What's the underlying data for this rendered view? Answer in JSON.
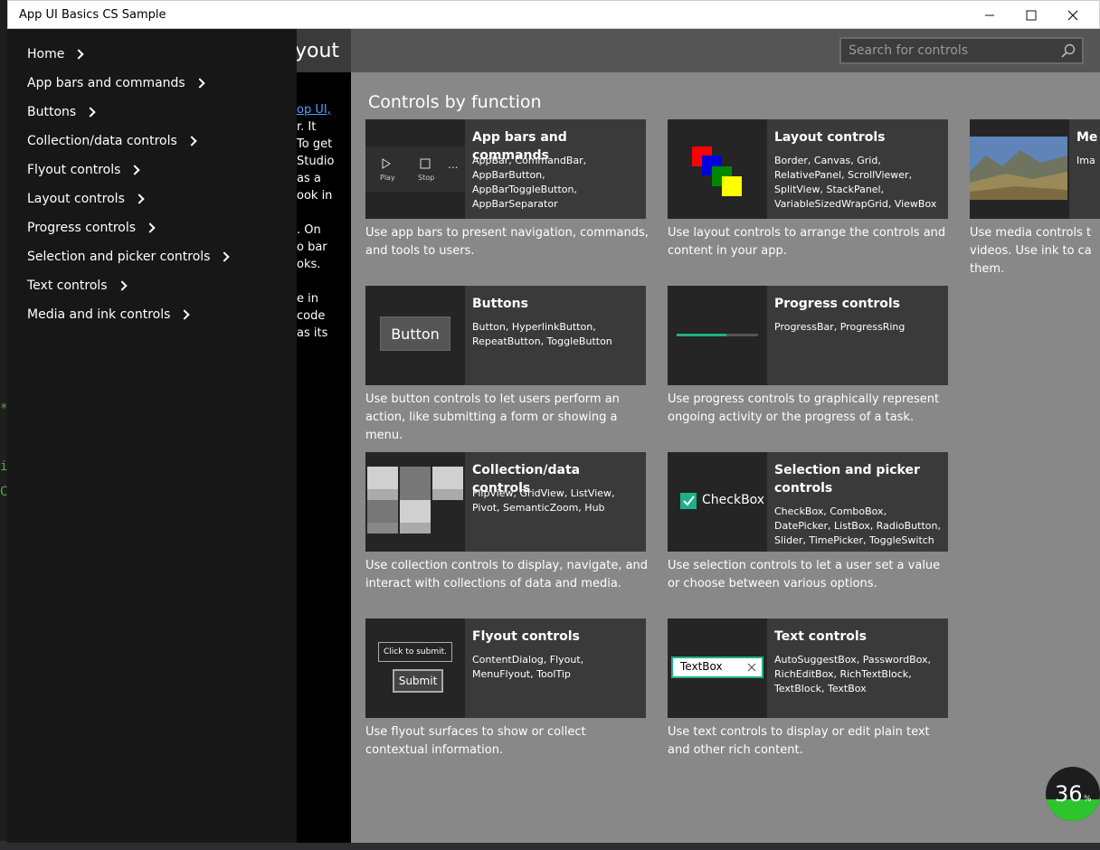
{
  "window": {
    "title": "App UI Basics CS Sample"
  },
  "header": {
    "page_title": "yout"
  },
  "search": {
    "placeholder": "Search for controls"
  },
  "nav": {
    "items": [
      {
        "label": "Home"
      },
      {
        "label": "App bars and commands"
      },
      {
        "label": "Buttons"
      },
      {
        "label": "Collection/data controls"
      },
      {
        "label": "Flyout controls"
      },
      {
        "label": "Layout controls"
      },
      {
        "label": "Progress controls"
      },
      {
        "label": "Selection and picker controls"
      },
      {
        "label": "Text controls"
      },
      {
        "label": "Media and ink controls"
      }
    ]
  },
  "intro": {
    "lines": [
      "op UI,",
      "r. It",
      "",
      "To get",
      "Studio",
      "as a",
      "ook in",
      "",
      ". On",
      "o bar",
      "oks.",
      "",
      "e in",
      "code",
      "as its"
    ]
  },
  "main": {
    "section_title": "Controls by function",
    "tiles": [
      {
        "title": "App bars and commands",
        "controls": "AppBar, CommandBar, AppBarButton, AppBarToggleButton, AppBarSeparator",
        "description": "Use app bars to present navigation, commands, and tools to users."
      },
      {
        "title": "Layout controls",
        "controls": "Border, Canvas, Grid, RelativePanel, ScrollViewer, SplitView, StackPanel, VariableSizedWrapGrid, ViewBox",
        "description": "Use layout controls to arrange the controls and content in your app."
      },
      {
        "title": "Me",
        "controls": "Ima",
        "description": "Use media controls t videos. Use ink to ca them."
      },
      {
        "title": "Buttons",
        "controls": "Button, HyperlinkButton, RepeatButton, ToggleButton",
        "description": "Use button controls to let users perform an action, like submitting a form or showing a menu."
      },
      {
        "title": "Progress controls",
        "controls": "ProgressBar, ProgressRing",
        "description": "Use progress controls to graphically represent ongoing activity or the progress of a task."
      },
      {
        "title": "Collection/data controls",
        "controls": "FlipView, GridView, ListView, Pivot, SemanticZoom, Hub",
        "description": "Use collection controls to display, navigate, and interact with collections of data and media."
      },
      {
        "title": "Selection and picker controls",
        "controls": "CheckBox, ComboBox, DatePicker, ListBox, RadioButton, Slider, TimePicker, ToggleSwitch",
        "description": "Use selection controls to let a user set a value or choose between various options."
      },
      {
        "title": "Flyout controls",
        "controls": "ContentDialog, Flyout, MenuFlyout, ToolTip",
        "description": "Use flyout surfaces to show or collect contextual information."
      },
      {
        "title": "Text controls",
        "controls": "AutoSuggestBox, PasswordBox, RichEditBox, RichTextBlock, TextBlock, TextBox",
        "description": "Use text controls to display or edit plain text and other rich content."
      }
    ],
    "thumbs": {
      "appbar_play": "Play",
      "appbar_stop": "Stop",
      "appbar_more": "...",
      "button_label": "Button",
      "checkbox_label": "CheckBox",
      "flyout_text": "Click to submit.",
      "flyout_submit": "Submit",
      "textbox_value": "TextBox"
    }
  },
  "badge": {
    "value": "36",
    "unit": "%"
  },
  "colors": {
    "accent": "#1eb087",
    "nav_bg": "#171717",
    "main_bg": "#888888",
    "tile_bg": "#3a3a3a"
  }
}
